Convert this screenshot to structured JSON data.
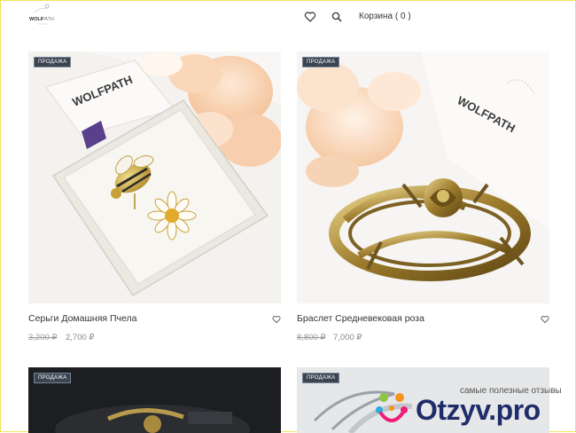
{
  "header": {
    "logo_text": "WOLFPATH",
    "icons": [
      "heart-icon",
      "search-icon"
    ],
    "cart_label": "Корзина ( 0 )"
  },
  "products": [
    {
      "badge": "ПРОДАЖА",
      "name": "Серьги Домашняя Пчела",
      "old_price": "3,200 ₽",
      "price": "2,700 ₽"
    },
    {
      "badge": "ПРОДАЖА",
      "name": "Браслет Средневековая роза",
      "old_price": "8,800 ₽",
      "price": "7,000 ₽"
    },
    {
      "badge": "ПРОДАЖА"
    },
    {
      "badge": "ПРОДАЖА"
    }
  ],
  "watermark": {
    "tagline": "самые полезные отзывы",
    "brand": "Otzyv.pro",
    "colors": {
      "brand": "#1f2c6b",
      "orange": "#f7941d",
      "green": "#8cc63f",
      "pink": "#ed1e79",
      "cyan": "#29abe2"
    }
  }
}
